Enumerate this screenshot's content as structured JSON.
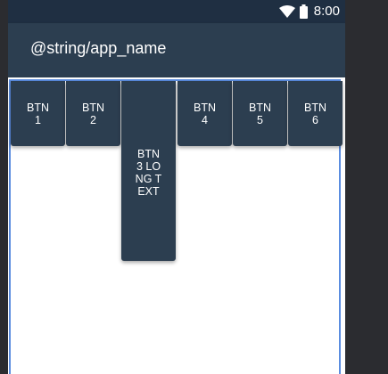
{
  "status_bar": {
    "time": "8:00",
    "icons": [
      "wifi-icon",
      "battery-icon"
    ]
  },
  "app_bar": {
    "title": "@string/app_name"
  },
  "buttons": [
    {
      "label": "BTN 1"
    },
    {
      "label": "BTN 2"
    },
    {
      "label": "BTN 3 LONG TEXT"
    },
    {
      "label": "BTN 4"
    },
    {
      "label": "BTN 5"
    },
    {
      "label": "BTN 6"
    }
  ],
  "colors": {
    "status_bar": "#1f2f42",
    "primary": "#2c3e50",
    "selection_outline": "#5b8de0",
    "background": "#ffffff"
  }
}
